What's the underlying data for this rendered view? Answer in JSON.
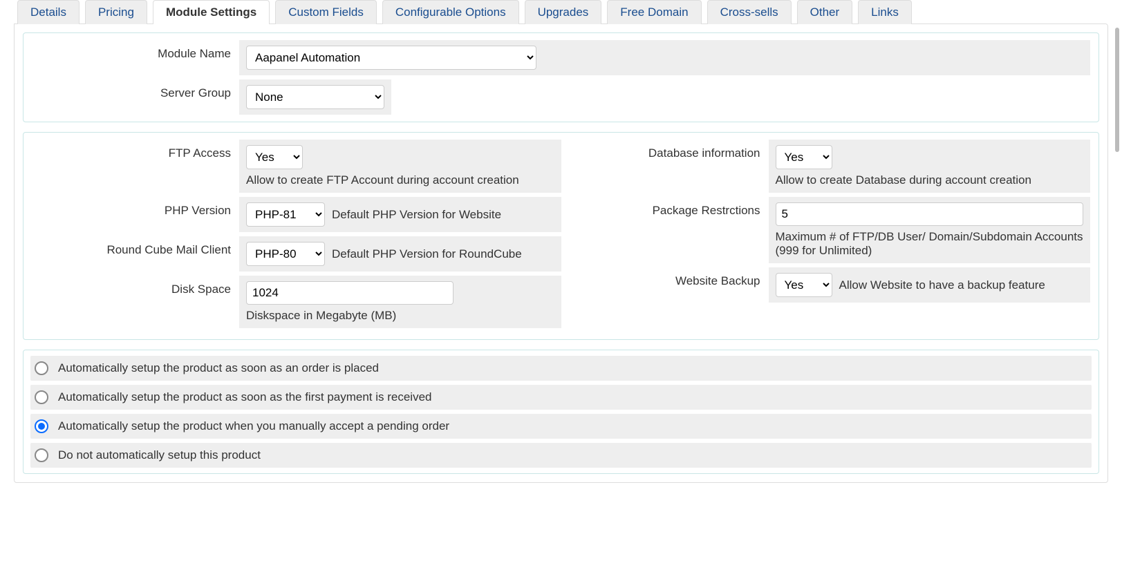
{
  "tabs": [
    "Details",
    "Pricing",
    "Module Settings",
    "Custom Fields",
    "Configurable Options",
    "Upgrades",
    "Free Domain",
    "Cross-sells",
    "Other",
    "Links"
  ],
  "active_tab": 2,
  "top": {
    "module_name_label": "Module Name",
    "module_name_value": "Aapanel Automation",
    "server_group_label": "Server Group",
    "server_group_value": "None"
  },
  "left": {
    "ftp_label": "FTP Access",
    "ftp_value": "Yes",
    "ftp_hint": "Allow to create FTP Account during account creation",
    "php_label": "PHP Version",
    "php_value": "PHP-81",
    "php_hint": "Default PHP Version for Website",
    "rc_label": "Round Cube Mail Client",
    "rc_value": "PHP-80",
    "rc_hint": "Default PHP Version for RoundCube",
    "disk_label": "Disk Space",
    "disk_value": "1024",
    "disk_hint": "Diskspace in Megabyte (MB)"
  },
  "right": {
    "db_label": "Database information",
    "db_value": "Yes",
    "db_hint": "Allow to create Database during account creation",
    "pkg_label": "Package Restrctions",
    "pkg_value": "5",
    "pkg_hint": "Maximum # of FTP/DB User/ Domain/Subdomain Accounts (999 for Unlimited)",
    "bak_label": "Website Backup",
    "bak_value": "Yes",
    "bak_hint": "Allow Website to have a backup feature"
  },
  "setup_options": [
    "Automatically setup the product as soon as an order is placed",
    "Automatically setup the product as soon as the first payment is received",
    "Automatically setup the product when you manually accept a pending order",
    "Do not automatically setup this product"
  ],
  "setup_selected": 2
}
